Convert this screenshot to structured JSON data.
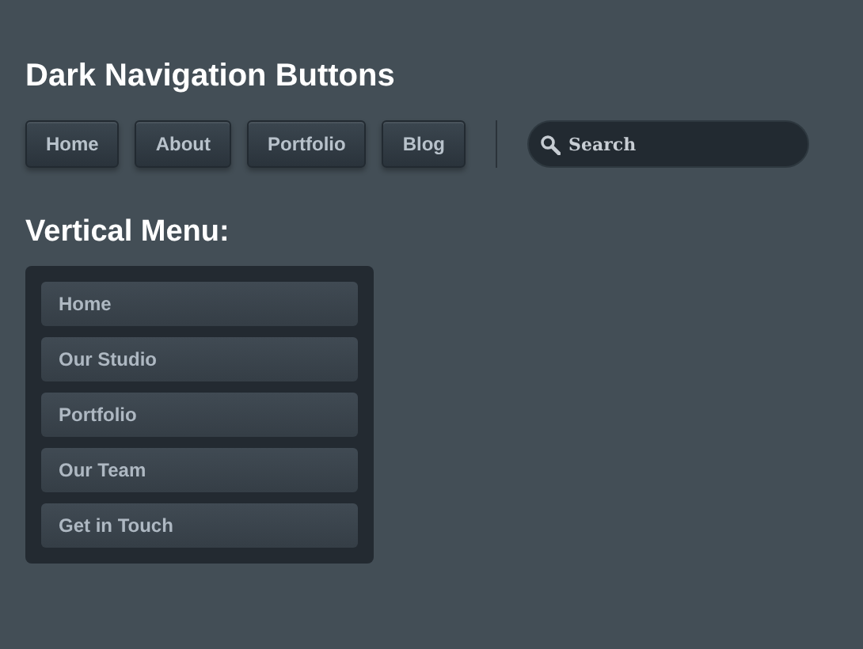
{
  "title": "Dark Navigation Buttons",
  "nav": [
    "Home",
    "About",
    "Portfolio",
    "Blog"
  ],
  "search": {
    "placeholder": "Search"
  },
  "vertical_title": "Vertical Menu:",
  "vertical_menu": [
    "Home",
    "Our Studio",
    "Portfolio",
    "Our Team",
    "Get in Touch"
  ]
}
